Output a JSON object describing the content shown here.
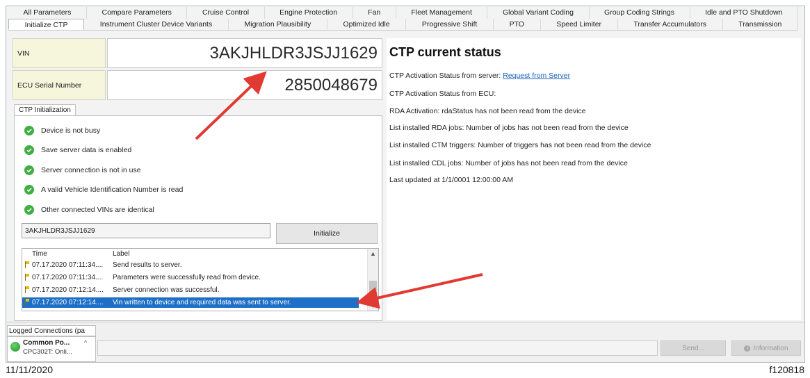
{
  "tabs": {
    "row1": [
      "All Parameters",
      "Compare Parameters",
      "Cruise Control",
      "Engine Protection",
      "Fan",
      "Fleet Management",
      "Global Variant Coding",
      "Group Coding Strings",
      "Idle and PTO Shutdown"
    ],
    "row2": [
      "Initialize CTP",
      "Instrument Cluster Device Variants",
      "Migration Plausibility",
      "Optimized Idle",
      "Progressive Shift",
      "PTO",
      "Speed Limiter",
      "Transfer Accumulators",
      "Transmission"
    ]
  },
  "vin": {
    "label": "VIN",
    "value": "3AKJHLDR3JSJJ1629"
  },
  "ecu": {
    "label": "ECU Serial Number",
    "value": "2850048679"
  },
  "ctp_init": {
    "tab_label": "CTP Initialization",
    "checks": [
      "Device is not busy",
      "Save server data is enabled",
      "Server connection is not in use",
      "A valid Vehicle Identification Number is read",
      "Other connected VINs are identical"
    ],
    "vin_input": "3AKJHLDR3JSJJ1629",
    "initialize_label": "Initialize"
  },
  "log": {
    "col_time": "Time",
    "col_label": "Label",
    "rows": [
      {
        "time": "07.17.2020 07:11:34....",
        "label": "Send results to server."
      },
      {
        "time": "07.17.2020 07:11:34....",
        "label": "Parameters were successfully read from device."
      },
      {
        "time": "07.17.2020 07:12:14....",
        "label": "Server connection was successful."
      },
      {
        "time": "07.17.2020 07:12:14....",
        "label": "Vin written to device and required data was sent to server."
      }
    ]
  },
  "status": {
    "title": "CTP current status",
    "server_label": "CTP Activation Status from server:",
    "server_link": "Request from Server",
    "ecu_line": "CTP Activation Status from ECU:",
    "lines": [
      "RDA Activation: rdaStatus has not been read from the device",
      "List installed RDA jobs: Number of jobs has not been read from the device",
      "List installed CTM triggers: Number of triggers has not been read from the device",
      "List installed CDL jobs: Number of jobs has not been read from the device",
      "Last updated at 1/1/0001 12:00:00 AM"
    ]
  },
  "connections": {
    "tab_label": "Logged Connections (pa",
    "name": "Common Po...",
    "status": "CPC302T: Onli..."
  },
  "buttons": {
    "send": "Send...",
    "information": "Information"
  },
  "footer": {
    "date": "11/11/2020",
    "code": "f120818"
  },
  "colors": {
    "accent": "#1d6fc7",
    "check": "#3fae43",
    "arrow": "#e03a32",
    "vin_label_bg": "#f6f6dc"
  },
  "icons": [
    "check-circle-icon",
    "log-flag-icon",
    "info-icon",
    "connection-status-icon",
    "annotation-arrow"
  ]
}
